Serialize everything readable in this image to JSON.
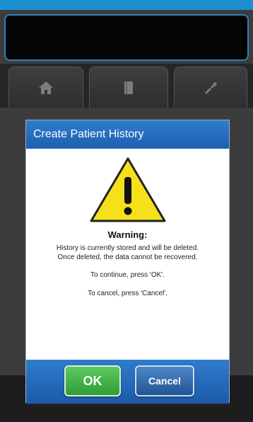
{
  "colors": {
    "accent": "#1c8fd0",
    "dialog_title_bg": "#2566b8",
    "ok_green": "#3aae3f",
    "cancel_blue": "#2e66a8",
    "warning_yellow": "#f4e11a"
  },
  "tabs": [
    {
      "icon": "home-icon"
    },
    {
      "icon": "book-icon"
    },
    {
      "icon": "tools-icon"
    }
  ],
  "dialog": {
    "title": "Create Patient History",
    "icon": "warning-icon",
    "heading": "Warning:",
    "line1": "History is currently stored and will be deleted.",
    "line2": "Once deleted, the data cannot be recovered.",
    "line3": "To continue, press 'OK'.",
    "line4": "To cancel, press 'Cancel'.",
    "ok_label": "OK",
    "cancel_label": "Cancel"
  }
}
